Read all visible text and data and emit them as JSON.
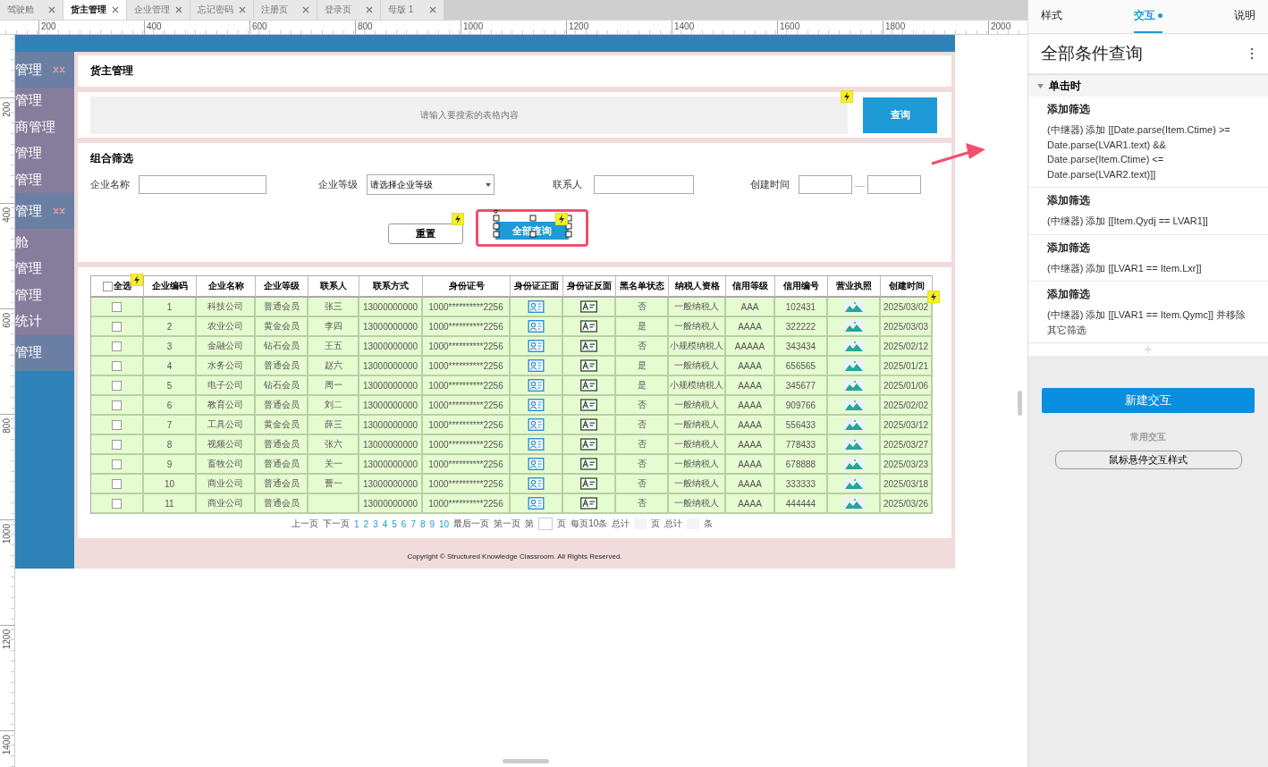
{
  "tabs": [
    {
      "label": "驾驶舱",
      "selected": false
    },
    {
      "label": "货主管理",
      "selected": true
    },
    {
      "label": "企业管理",
      "selected": false
    },
    {
      "label": "忘记密码",
      "selected": false
    },
    {
      "label": "注册页",
      "selected": false
    },
    {
      "label": "登录页",
      "selected": false
    },
    {
      "label": "母版 1",
      "selected": false
    }
  ],
  "ruler": {
    "x_labels": [
      "200",
      "400",
      "600",
      "800",
      "1000",
      "1200",
      "1400",
      "1600",
      "1800",
      "2000"
    ],
    "y_labels": [
      "200",
      "400",
      "600",
      "800",
      "1000",
      "1200",
      "1400"
    ]
  },
  "sidebar": {
    "items": [
      {
        "label": "管理",
        "kind": "group"
      },
      {
        "label": "管理",
        "kind": "item"
      },
      {
        "label": "商管理",
        "kind": "item"
      },
      {
        "label": "管理",
        "kind": "item"
      },
      {
        "label": "管理",
        "kind": "item"
      },
      {
        "label": "管理",
        "kind": "group"
      },
      {
        "label": "舱",
        "kind": "item"
      },
      {
        "label": "管理",
        "kind": "item"
      },
      {
        "label": "管理",
        "kind": "item"
      },
      {
        "label": "统计",
        "kind": "item"
      },
      {
        "label": "管理",
        "kind": "header"
      }
    ]
  },
  "page_title": "货主管理",
  "search": {
    "placeholder": "请输入要搜索的表格内容",
    "button": "查询"
  },
  "filter": {
    "title": "组合筛选",
    "name_label": "企业名称",
    "level_label": "企业等级",
    "level_placeholder": "请选择企业等级",
    "contact_label": "联系人",
    "time_label": "创建时间",
    "time_separator": "—",
    "buttons": [
      {
        "label": "重置",
        "kind": "secondary",
        "selected": false
      },
      {
        "label": "全部查询",
        "kind": "primary",
        "selected": true
      }
    ]
  },
  "table": {
    "select_all": "全选",
    "select_all_checked": false,
    "columns": [
      "企业编码",
      "企业名称",
      "企业等级",
      "联系人",
      "联系方式",
      "身份证号",
      "身份证正面",
      "身份证反面",
      "黑名单状态",
      "纳税人资格",
      "信用等级",
      "信用编号",
      "营业执照",
      "创建时间"
    ],
    "rows": [
      {
        "checked": false,
        "cells": [
          "1",
          "科技公司",
          "普通会员",
          "张三",
          "13000000000",
          "1000**********2256",
          {
            "kind": "id_front"
          },
          {
            "kind": "id_back"
          },
          "否",
          "一般纳税人",
          "AAA",
          "102431",
          {
            "kind": "license"
          },
          "2025/03/02"
        ]
      },
      {
        "checked": false,
        "cells": [
          "2",
          "农业公司",
          "黄金会员",
          "李四",
          "13000000000",
          "1000**********2256",
          {
            "kind": "id_front"
          },
          {
            "kind": "id_back"
          },
          "是",
          "一般纳税人",
          "AAAA",
          "322222",
          {
            "kind": "license"
          },
          "2025/03/03"
        ]
      },
      {
        "checked": false,
        "cells": [
          "3",
          "金融公司",
          "钻石会员",
          "王五",
          "13000000000",
          "1000**********2256",
          {
            "kind": "id_front"
          },
          {
            "kind": "id_back"
          },
          "否",
          "小规模纳税人",
          "AAAAA",
          "343434",
          {
            "kind": "license"
          },
          "2025/02/12"
        ]
      },
      {
        "checked": false,
        "cells": [
          "4",
          "水务公司",
          "普通会员",
          "赵六",
          "13000000000",
          "1000**********2256",
          {
            "kind": "id_front"
          },
          {
            "kind": "id_back"
          },
          "是",
          "一般纳税人",
          "AAAA",
          "656565",
          {
            "kind": "license"
          },
          "2025/01/21"
        ]
      },
      {
        "checked": false,
        "cells": [
          "5",
          "电子公司",
          "钻石会员",
          "周一",
          "13000000000",
          "1000**********2256",
          {
            "kind": "id_front"
          },
          {
            "kind": "id_back"
          },
          "是",
          "小规模纳税人",
          "AAAA",
          "345677",
          {
            "kind": "license"
          },
          "2025/01/06"
        ]
      },
      {
        "checked": false,
        "cells": [
          "6",
          "教育公司",
          "普通会员",
          "刘二",
          "13000000000",
          "1000**********2256",
          {
            "kind": "id_front"
          },
          {
            "kind": "id_back"
          },
          "否",
          "一般纳税人",
          "AAAA",
          "909766",
          {
            "kind": "license"
          },
          "2025/02/02"
        ]
      },
      {
        "checked": false,
        "cells": [
          "7",
          "工具公司",
          "黄金会员",
          "薛三",
          "13000000000",
          "1000**********2256",
          {
            "kind": "id_front"
          },
          {
            "kind": "id_back"
          },
          "否",
          "一般纳税人",
          "AAAA",
          "556433",
          {
            "kind": "license"
          },
          "2025/03/12"
        ]
      },
      {
        "checked": false,
        "cells": [
          "8",
          "视频公司",
          "普通会员",
          "张六",
          "13000000000",
          "1000**********2256",
          {
            "kind": "id_front"
          },
          {
            "kind": "id_back"
          },
          "否",
          "一般纳税人",
          "AAAA",
          "778433",
          {
            "kind": "license"
          },
          "2025/03/27"
        ]
      },
      {
        "checked": false,
        "cells": [
          "9",
          "畜牧公司",
          "普通会员",
          "关一",
          "13000000000",
          "1000**********2256",
          {
            "kind": "id_front"
          },
          {
            "kind": "id_back"
          },
          "否",
          "一般纳税人",
          "AAAA",
          "678888",
          {
            "kind": "license"
          },
          "2025/03/23"
        ]
      },
      {
        "checked": false,
        "cells": [
          "10",
          "商业公司",
          "普通会员",
          "曹一",
          "13000000000",
          "1000**********2256",
          {
            "kind": "id_front"
          },
          {
            "kind": "id_back"
          },
          "否",
          "一般纳税人",
          "AAAA",
          "333333",
          {
            "kind": "license"
          },
          "2025/03/18"
        ]
      },
      {
        "checked": false,
        "cells": [
          "11",
          "商业公司",
          "普通会员",
          "",
          "13000000000",
          "1000**********2256",
          {
            "kind": "id_front"
          },
          {
            "kind": "id_back"
          },
          "否",
          "一般纳税人",
          "AAAA",
          "444444",
          {
            "kind": "license"
          },
          "2025/03/26"
        ]
      }
    ]
  },
  "pagination": {
    "prev": "上一页",
    "next": "下一页",
    "pages": [
      "1",
      "2",
      "3",
      "4",
      "5",
      "6",
      "7",
      "8",
      "9",
      "10"
    ],
    "last": "最后一页",
    "first": "第一页",
    "goto_before": "第",
    "goto_after": "页",
    "per_page": "每页10条",
    "total_pages_before": "总计",
    "total_pages_after": "页",
    "total_items_before": "总计",
    "total_items_after": "条"
  },
  "copyright": "Copyright © Structured Knowledge Classroom. All Rights Reserved.",
  "panel": {
    "tabs": [
      {
        "label": "样式",
        "selected": false,
        "dot": false
      },
      {
        "label": "交互",
        "selected": true,
        "dot": true
      },
      {
        "label": "说明",
        "selected": false,
        "dot": false
      }
    ],
    "title": "全部条件查询",
    "event": {
      "label": "单击时",
      "expanded": true
    },
    "actions": [
      {
        "title": "添加筛选",
        "text": "(中继器) 添加 [[Date.parse(Item.Ctime) >= Date.parse(LVAR1.text) && Date.parse(Item.Ctime) <= Date.parse(LVAR2.text)]]"
      },
      {
        "title": "添加筛选",
        "text": "(中继器) 添加 [[Item.Qydj == LVAR1]]"
      },
      {
        "title": "添加筛选",
        "text": "(中继器) 添加 [[LVAR1 == Item.Lxr]]"
      },
      {
        "title": "添加筛选",
        "text": "(中继器) 添加 [[LVAR1 == Item.Qymc]] 并移除其它筛选"
      }
    ],
    "new_button": "新建交互",
    "common_label": "常用交互",
    "hover_button": "鼠标悬停交互样式"
  }
}
